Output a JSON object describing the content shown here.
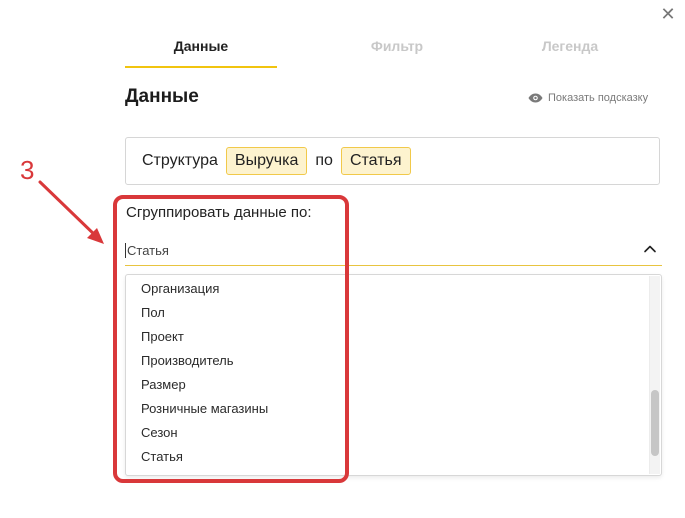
{
  "dialog": {
    "close_label": "✕"
  },
  "tabs": [
    {
      "label": "Данные",
      "active": true
    },
    {
      "label": "Фильтр",
      "active": false
    },
    {
      "label": "Легенда",
      "active": false
    }
  ],
  "section": {
    "title": "Данные",
    "hint_label": "Показать подсказку"
  },
  "structure": {
    "label": "Структура",
    "measure": "Выручка",
    "connector": "по",
    "dimension": "Статья"
  },
  "group_by": {
    "label": "Сгруппировать данные по:",
    "value": "Статья",
    "options": [
      "Организация",
      "Пол",
      "Проект",
      "Производитель",
      "Размер",
      "Розничные магазины",
      "Сезон",
      "Статья"
    ]
  },
  "annotation": {
    "number": "3",
    "color": "#d9383a"
  },
  "colors": {
    "accent": "#f1c40f",
    "chip_bg": "#fdf3cf",
    "chip_border": "#f1c94a"
  }
}
